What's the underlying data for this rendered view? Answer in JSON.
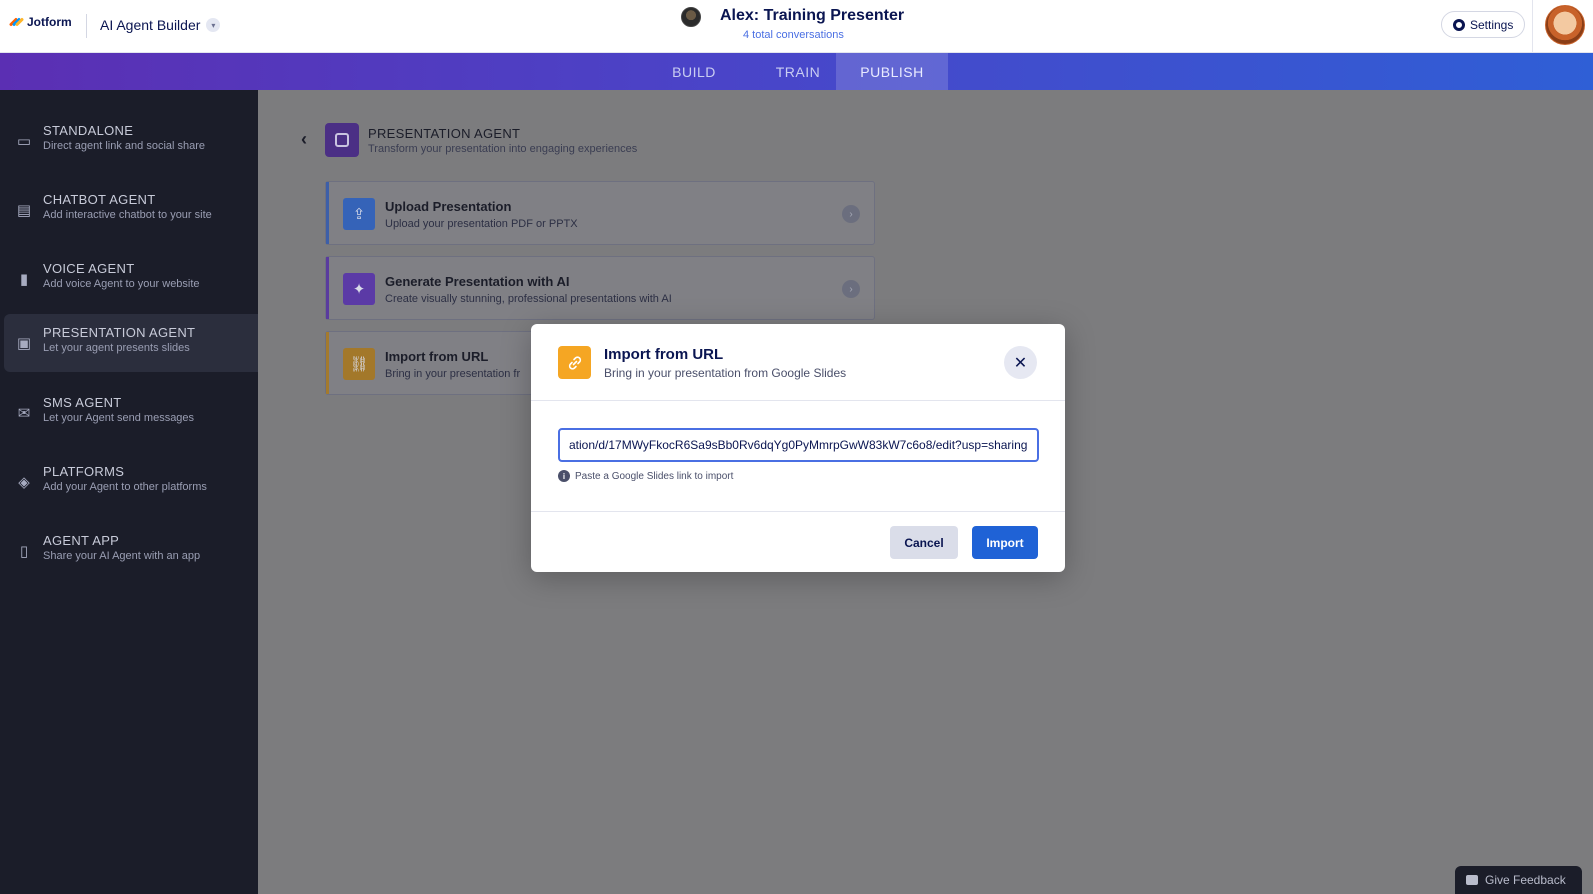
{
  "header": {
    "logo_text": "Jotform",
    "builder_title": "AI Agent Builder",
    "agent_name": "Alex: Training Presenter",
    "agent_subtitle": "4 total conversations",
    "settings_label": "Settings"
  },
  "nav": {
    "tabs": [
      {
        "label": "BUILD"
      },
      {
        "label": "TRAIN"
      },
      {
        "label": "PUBLISH"
      }
    ],
    "active_tab": "PUBLISH"
  },
  "sidebar": {
    "items": [
      {
        "title": "STANDALONE",
        "desc": "Direct agent link and social share",
        "icon": "monitor-icon"
      },
      {
        "title": "CHATBOT AGENT",
        "desc": "Add interactive chatbot to your site",
        "icon": "chat-icon"
      },
      {
        "title": "VOICE AGENT",
        "desc": "Add voice Agent to your website",
        "icon": "voice-bars-icon"
      },
      {
        "title": "PRESENTATION AGENT",
        "desc": "Let your agent presents slides",
        "icon": "presentation-icon"
      },
      {
        "title": "SMS AGENT",
        "desc": "Let your Agent send messages",
        "icon": "sms-icon"
      },
      {
        "title": "PLATFORMS",
        "desc": "Add your Agent to other platforms",
        "icon": "layers-icon"
      },
      {
        "title": "AGENT APP",
        "desc": "Share your AI Agent with an app",
        "icon": "phone-icon"
      }
    ],
    "active_index": 3
  },
  "main": {
    "section_title": "PRESENTATION AGENT",
    "section_desc": "Transform your presentation into engaging experiences",
    "options": [
      {
        "title": "Upload Presentation",
        "desc": "Upload your presentation PDF or PPTX",
        "color": "#2f7bf0"
      },
      {
        "title": "Generate Presentation with AI",
        "desc": "Create visually stunning, professional presentations with AI",
        "color": "#7a4fe0"
      },
      {
        "title": "Import from URL",
        "desc": "Bring in your presentation fr",
        "color": "#f5a623"
      }
    ]
  },
  "modal": {
    "title": "Import from URL",
    "subtitle": "Bring in your presentation from Google Slides",
    "input_value": "ation/d/17MWyFkocR6Sa9sBb0Rv6dqYg0PyMmrpGwW83kW7c6o8/edit?usp=sharing",
    "hint": "Paste a Google Slides link to import",
    "cancel_label": "Cancel",
    "import_label": "Import"
  },
  "feedback": {
    "label": "Give Feedback"
  },
  "colors": {
    "accent": "#1f62d6",
    "sidebar_bg": "#1b1d29",
    "modal_icon": "#f5a623"
  }
}
